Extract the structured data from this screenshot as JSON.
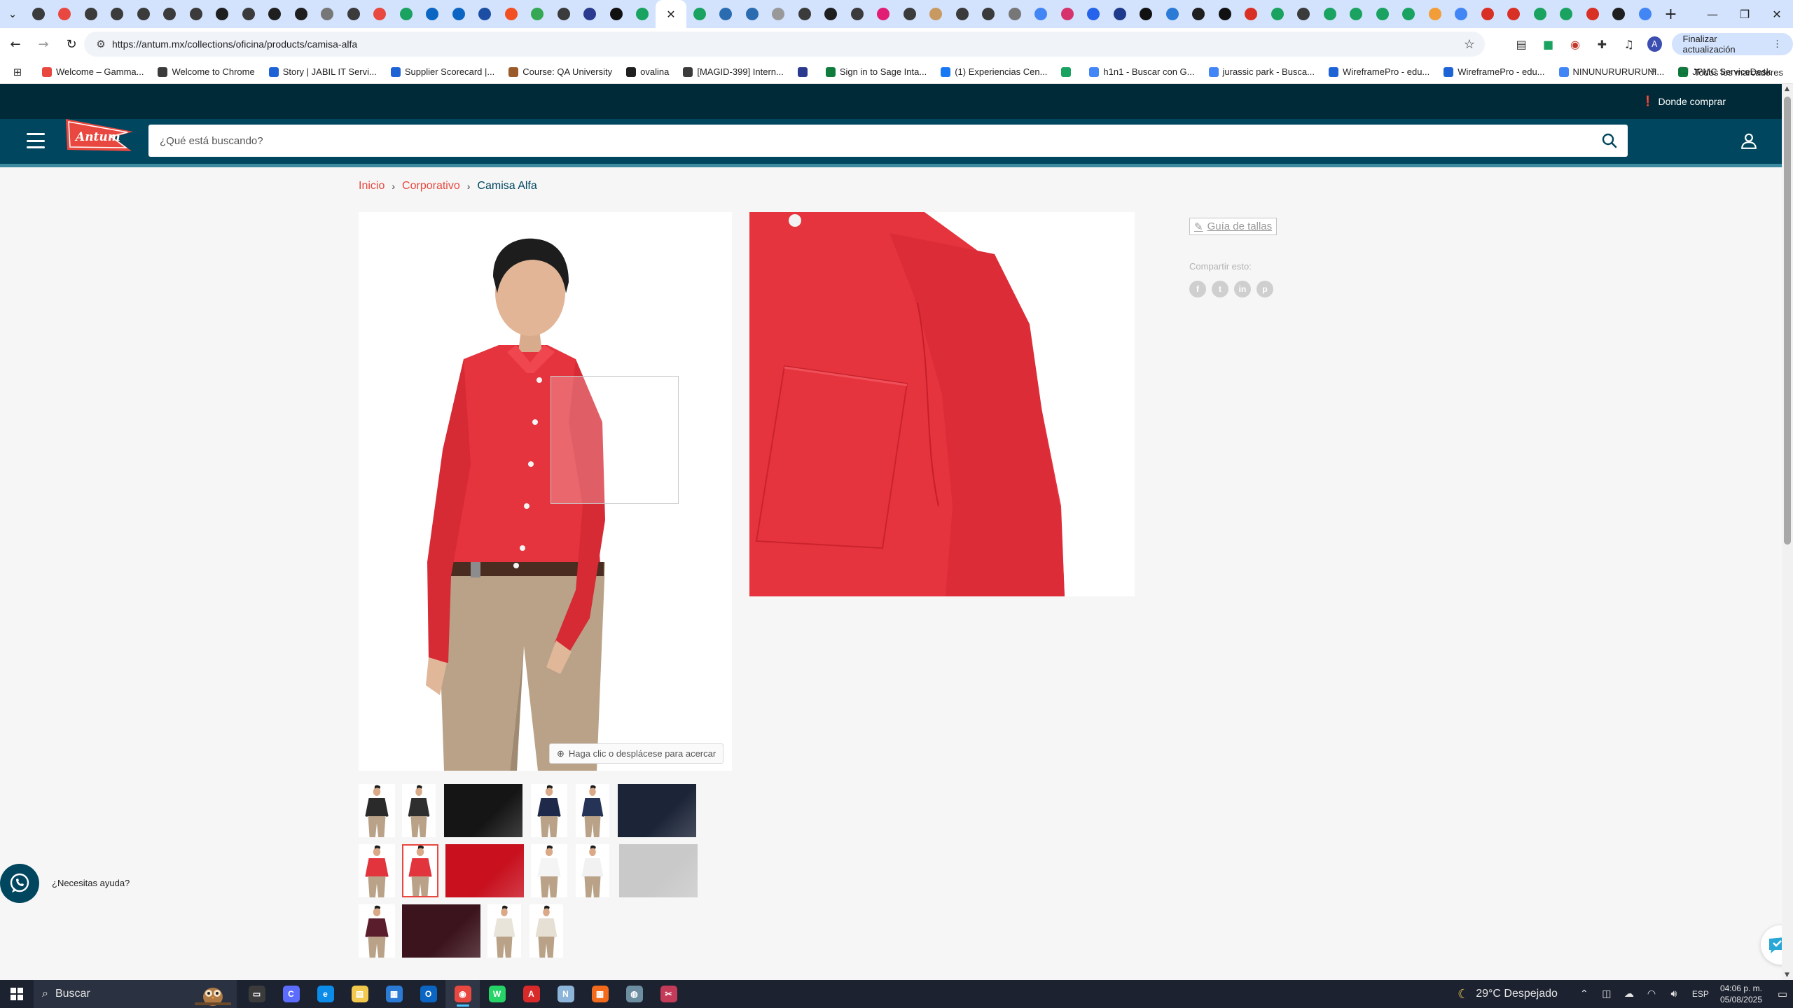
{
  "browser": {
    "tabs": [
      {
        "icon": "crop-icon",
        "color": "#3b3b3b"
      },
      {
        "icon": "tools-icon",
        "color": "#e8483f"
      },
      {
        "icon": "crop-icon",
        "color": "#3b3b3b"
      },
      {
        "icon": "crop-icon",
        "color": "#3b3b3b"
      },
      {
        "icon": "crop-icon",
        "color": "#3b3b3b"
      },
      {
        "icon": "crop-icon",
        "color": "#3b3b3b"
      },
      {
        "icon": "crop-icon",
        "color": "#3b3b3b"
      },
      {
        "icon": "link-icon",
        "color": "#1f1f1f"
      },
      {
        "icon": "crop-icon",
        "color": "#3b3b3b"
      },
      {
        "icon": "github-icon",
        "color": "#1f1f1f"
      },
      {
        "icon": "github-icon",
        "color": "#1f1f1f"
      },
      {
        "icon": "dash-icon",
        "color": "#777777"
      },
      {
        "icon": "crop-icon",
        "color": "#3b3b3b"
      },
      {
        "icon": "loader-icon",
        "color": "#e8483f"
      },
      {
        "icon": "sheets-icon",
        "color": "#1aa260"
      },
      {
        "icon": "outlook-icon",
        "color": "#0a66c2"
      },
      {
        "icon": "globe-icon",
        "color": "#0a66c2"
      },
      {
        "icon": "yammer-icon",
        "color": "#1c4fa3"
      },
      {
        "icon": "microsoft-icon",
        "color": "#f25022"
      },
      {
        "icon": "maps-icon",
        "color": "#34a853"
      },
      {
        "icon": "crop-icon",
        "color": "#3b3b3b"
      },
      {
        "icon": "app-icon",
        "color": "#2b3a8f"
      },
      {
        "icon": "x-icon",
        "color": "#111111"
      },
      {
        "icon": "clipboard-icon",
        "color": "#1aa260"
      }
    ],
    "active_tab_icon": "close-icon",
    "tabs_after": [
      {
        "icon": "drive-icon",
        "color": "#1aa260"
      },
      {
        "icon": "app-icon",
        "color": "#2b6cb0"
      },
      {
        "icon": "globe-icon",
        "color": "#2b6cb0"
      },
      {
        "icon": "circle-icon",
        "color": "#999999"
      },
      {
        "icon": "crop-icon",
        "color": "#3b3b3b"
      },
      {
        "icon": "p-icon",
        "color": "#1f1f1f"
      },
      {
        "icon": "crop-icon",
        "color": "#3b3b3b"
      },
      {
        "icon": "app-icon",
        "color": "#e11d74"
      },
      {
        "icon": "crop-icon",
        "color": "#3b3b3b"
      },
      {
        "icon": "circle-icon",
        "color": "#c89a62"
      },
      {
        "icon": "crop-icon",
        "color": "#3b3b3b"
      },
      {
        "icon": "crop-icon",
        "color": "#3b3b3b"
      },
      {
        "icon": "dash-icon",
        "color": "#777777"
      },
      {
        "icon": "google-icon",
        "color": "#4285f4"
      },
      {
        "icon": "app-icon",
        "color": "#d6336c"
      },
      {
        "icon": "app-icon",
        "color": "#2563eb"
      },
      {
        "icon": "app-icon",
        "color": "#1e3a8a"
      },
      {
        "icon": "app-icon",
        "color": "#111111"
      },
      {
        "icon": "app-icon",
        "color": "#2b7bd6"
      },
      {
        "icon": "amazon-icon",
        "color": "#1f1f1f"
      },
      {
        "icon": "app-icon",
        "color": "#111111"
      },
      {
        "icon": "gmail-icon",
        "color": "#d93025"
      },
      {
        "icon": "app-icon",
        "color": "#1aa260"
      },
      {
        "icon": "crop-icon",
        "color": "#3b3b3b"
      },
      {
        "icon": "app-icon",
        "color": "#1aa260"
      },
      {
        "icon": "app-icon",
        "color": "#1aa260"
      },
      {
        "icon": "app-icon",
        "color": "#1aa260"
      },
      {
        "icon": "app-icon",
        "color": "#1aa260"
      },
      {
        "icon": "app-icon",
        "color": "#f29d38"
      },
      {
        "icon": "google-icon",
        "color": "#4285f4"
      },
      {
        "icon": "gmail-icon",
        "color": "#d93025"
      },
      {
        "icon": "app-icon",
        "color": "#d93025"
      },
      {
        "icon": "app-icon",
        "color": "#1aa260"
      },
      {
        "icon": "app-icon",
        "color": "#1aa260"
      },
      {
        "icon": "app-icon",
        "color": "#d93025"
      },
      {
        "icon": "link-icon",
        "color": "#1f1f1f"
      },
      {
        "icon": "docs-icon",
        "color": "#4285f4"
      }
    ],
    "url": "https://antum.mx/collections/oficina/products/camisa-alfa",
    "update_button": "Finalizar actualización",
    "avatar_letter": "A",
    "bookmarks": [
      {
        "label": "Welcome – Gamma...",
        "color": "#e8483f"
      },
      {
        "label": "Welcome to Chrome",
        "color": "#3b3b3b"
      },
      {
        "label": "Story | JABIL IT Servi...",
        "color": "#1e63d6"
      },
      {
        "label": "Supplier Scorecard |...",
        "color": "#1e63d6"
      },
      {
        "label": "Course: QA University",
        "color": "#9a5b2b"
      },
      {
        "label": "ovalina",
        "color": "#1f1f1f"
      },
      {
        "label": "[MAGID-399] Intern...",
        "color": "#3b3b3b"
      },
      {
        "label": "",
        "color": "#2b3a8f"
      },
      {
        "label": "Sign in to Sage Inta...",
        "color": "#0f7b3c"
      },
      {
        "label": "(1) Experiencias Cen...",
        "color": "#1877f2"
      },
      {
        "label": "",
        "color": "#1aa260"
      },
      {
        "label": "h1n1 - Buscar con G...",
        "color": "#4285f4"
      },
      {
        "label": "jurassic park - Busca...",
        "color": "#4285f4"
      },
      {
        "label": "WireframePro - edu...",
        "color": "#1e63d6"
      },
      {
        "label": "WireframePro - edu...",
        "color": "#1e63d6"
      },
      {
        "label": "NINUNURURURUNI...",
        "color": "#4285f4"
      },
      {
        "label": "JPMC ServiceDesk",
        "color": "#0f7b3c"
      }
    ],
    "all_bookmarks": "Todos los marcadores"
  },
  "site": {
    "where_to_buy": "Donde comprar",
    "logo_text": "Antum",
    "search_placeholder": "¿Qué está buscando?",
    "breadcrumb": [
      {
        "label": "Inicio",
        "current": false
      },
      {
        "label": "Corporativo",
        "current": false
      },
      {
        "label": "Camisa Alfa",
        "current": true
      }
    ],
    "zoom_hint": "Haga clic o desplácese para acercar",
    "size_guide": "Guía de tallas",
    "share_label": "Compartir esto:",
    "share_icons": [
      {
        "name": "facebook-icon",
        "glyph": "f"
      },
      {
        "name": "twitter-icon",
        "glyph": "t"
      },
      {
        "name": "linkedin-icon",
        "glyph": "in"
      },
      {
        "name": "pinterest-icon",
        "glyph": "p"
      }
    ],
    "help_label": "¿Necesitas ayuda?",
    "thumbnails": [
      {
        "color": "#2a2a2a",
        "kind": "model",
        "selected": false
      },
      {
        "color": "#2f2f2f",
        "kind": "model",
        "selected": false
      },
      {
        "color": "#151515",
        "kind": "fabric",
        "selected": false
      },
      {
        "color": "#1f2a4a",
        "kind": "model",
        "selected": false
      },
      {
        "color": "#253456",
        "kind": "model",
        "selected": false
      },
      {
        "color": "#1c2538",
        "kind": "fabric",
        "selected": false
      },
      {
        "color": "#e2343d",
        "kind": "model",
        "selected": false
      },
      {
        "color": "#e2343d",
        "kind": "model",
        "selected": true
      },
      {
        "color": "#c8101e",
        "kind": "fabric",
        "selected": false
      },
      {
        "color": "#f4f4f4",
        "kind": "model",
        "selected": false
      },
      {
        "color": "#f1f1f1",
        "kind": "model",
        "selected": false
      },
      {
        "color": "#c9c9c9",
        "kind": "fabric",
        "selected": false
      },
      {
        "color": "#5a1d2b",
        "kind": "model",
        "selected": false
      },
      {
        "color": "#3c141d",
        "kind": "fabric",
        "selected": false
      },
      {
        "color": "#e9e4da",
        "kind": "model",
        "selected": false
      },
      {
        "color": "#e5dfd4",
        "kind": "model",
        "selected": false
      }
    ]
  },
  "taskbar": {
    "search_label": "Buscar",
    "apps": [
      {
        "icon": "task-view-icon",
        "color": "#3b3b3b",
        "glyph": "▭",
        "active": false
      },
      {
        "icon": "copilot-icon",
        "color": "#5b6cff",
        "glyph": "C",
        "active": false
      },
      {
        "icon": "edge-icon",
        "color": "#0c8ce9",
        "glyph": "e",
        "active": false
      },
      {
        "icon": "file-explorer-icon",
        "color": "#f2c94c",
        "glyph": "▤",
        "active": false
      },
      {
        "icon": "store-icon",
        "color": "#2b7bd6",
        "glyph": "▦",
        "active": false
      },
      {
        "icon": "outlook-icon",
        "color": "#0a66c2",
        "glyph": "O",
        "active": false
      },
      {
        "icon": "chrome-icon",
        "color": "#e8483f",
        "glyph": "◉",
        "active": true
      },
      {
        "icon": "whatsapp-app-icon",
        "color": "#25d366",
        "glyph": "W",
        "active": false
      },
      {
        "icon": "acrobat-icon",
        "color": "#d92a2a",
        "glyph": "A",
        "active": false
      },
      {
        "icon": "notes-icon",
        "color": "#8db5d9",
        "glyph": "N",
        "active": false
      },
      {
        "icon": "colors-app-icon",
        "color": "#f26b1d",
        "glyph": "▦",
        "active": false
      },
      {
        "icon": "app-icon",
        "color": "#6c8ea0",
        "glyph": "◍",
        "active": false
      },
      {
        "icon": "snip-icon",
        "color": "#c43b5a",
        "glyph": "✂",
        "active": false
      }
    ],
    "weather": "29°C  Despejado",
    "language": "ESP",
    "time": "04:06 p. m.",
    "date": "05/08/2025"
  }
}
